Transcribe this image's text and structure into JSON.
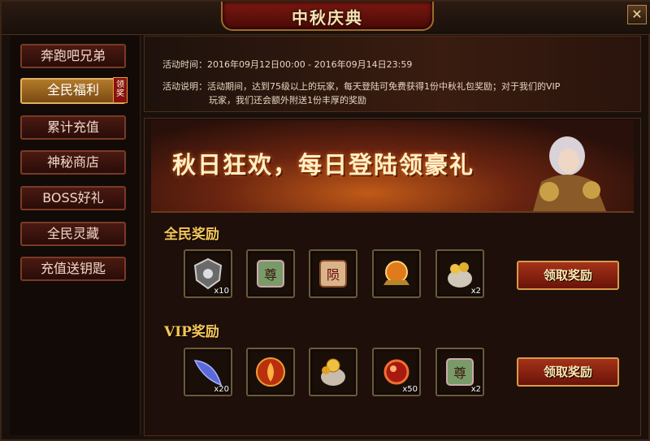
{
  "window": {
    "title": "中秋庆典"
  },
  "sidebar": {
    "items": [
      {
        "label": "奔跑吧兄弟"
      },
      {
        "label": "全民福利",
        "badge": "领奖"
      },
      {
        "label": "累计充值"
      },
      {
        "label": "神秘商店"
      },
      {
        "label": "BOSS好礼"
      },
      {
        "label": "全民灵藏"
      },
      {
        "label": "充值送钥匙"
      }
    ]
  },
  "info": {
    "time_label": "活动时间：",
    "time_value": "2016年09月12日00:00 - 2016年09月14日23:59",
    "desc_label": "活动说明：",
    "desc_line1": "活动期间，达到75级以上的玩家，每天登陆可免费获得1份中秋礼包奖励；对于我们的VIP",
    "desc_line2": "玩家，我们还会额外附送1份丰厚的奖励"
  },
  "banner": {
    "text": "秋日狂欢，每日登陆领豪礼"
  },
  "sections": {
    "all": {
      "title": "全民奖励",
      "claim_label": "领取奖励",
      "items": [
        {
          "icon": "stone-shield-icon",
          "qty": "x10"
        },
        {
          "icon": "scroll-zun-icon",
          "glyph": "尊",
          "qty": ""
        },
        {
          "icon": "scroll-yun-icon",
          "glyph": "陨",
          "qty": ""
        },
        {
          "icon": "fire-orb-icon",
          "qty": ""
        },
        {
          "icon": "gold-bag-icon",
          "qty": "x2"
        }
      ]
    },
    "vip": {
      "title": "VIP奖励",
      "claim_label": "领取奖励",
      "items": [
        {
          "icon": "feather-icon",
          "qty": "x20"
        },
        {
          "icon": "flame-badge-icon",
          "qty": ""
        },
        {
          "icon": "coin-sack-icon",
          "qty": ""
        },
        {
          "icon": "red-orb-icon",
          "qty": "x50"
        },
        {
          "icon": "scroll-zun-icon",
          "glyph": "尊",
          "qty": "x2"
        }
      ]
    }
  },
  "colors": {
    "accent_gold": "#f6c75a",
    "button_red": "#a4321a"
  }
}
